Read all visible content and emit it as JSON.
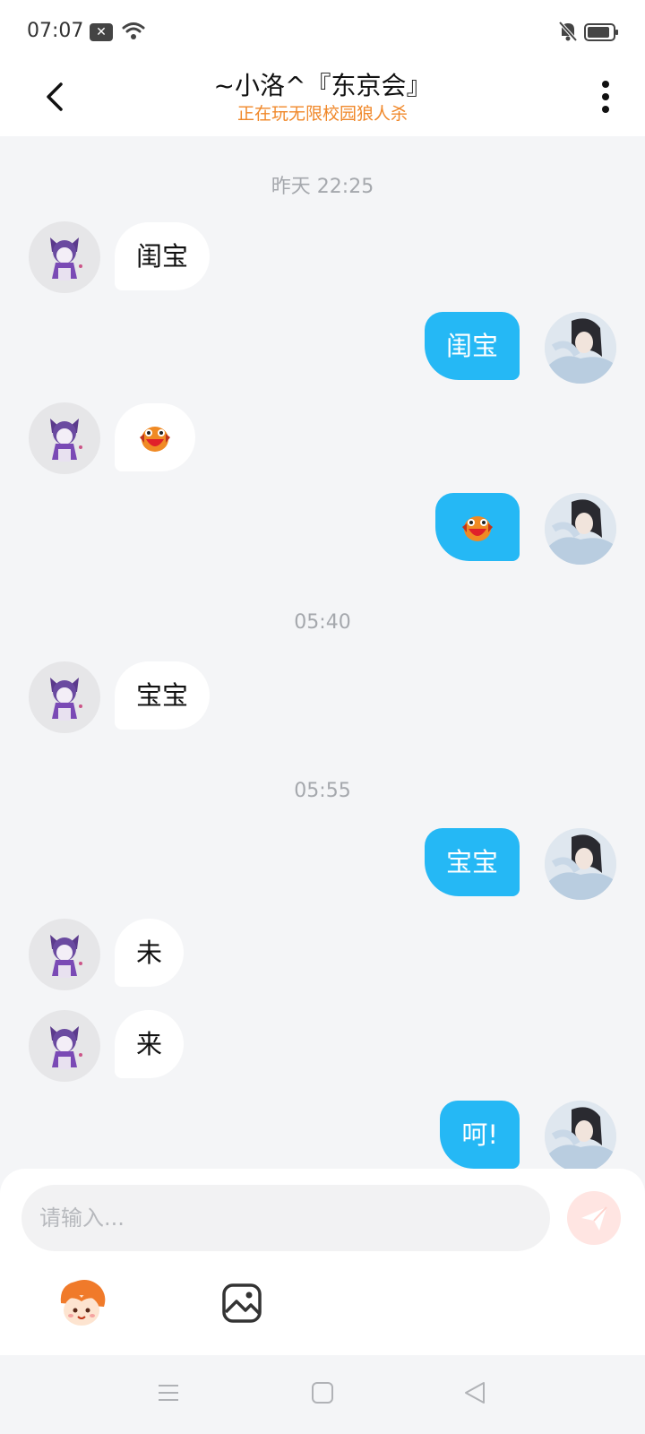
{
  "status": {
    "time": "07:07",
    "notification_icon": "close-notification-icon",
    "wifi_icon": "wifi-icon",
    "silent_icon": "bell-off-icon",
    "battery_icon": "battery-icon"
  },
  "header": {
    "title": "~小洛^『东京会』",
    "subtitle": "正在玩无限校园狼人杀",
    "back_icon": "chevron-left-icon",
    "more_icon": "more-vertical-icon"
  },
  "colors": {
    "accent": "#25b8f5",
    "subtitle": "#f0882a",
    "background": "#f4f5f7"
  },
  "chat": {
    "timestamps": [
      "昨天 22:25",
      "05:40",
      "05:55"
    ],
    "messages": [
      {
        "side": "left",
        "text": "闺宝"
      },
      {
        "side": "right",
        "text": "闺宝"
      },
      {
        "side": "left",
        "sticker": "red-bird-sticker"
      },
      {
        "side": "right",
        "sticker": "red-bird-sticker"
      },
      {
        "side": "left",
        "text": "宝宝"
      },
      {
        "side": "right",
        "text": "宝宝"
      },
      {
        "side": "left",
        "text": "未"
      },
      {
        "side": "left",
        "text": "来"
      },
      {
        "side": "right",
        "text": "呵!"
      }
    ]
  },
  "composer": {
    "placeholder": "请输入...",
    "send_icon": "paper-plane-icon",
    "emoji_icon": "emoji-mascot-icon",
    "image_icon": "image-icon"
  },
  "navbar": {
    "menu_icon": "menu-icon",
    "home_icon": "home-square-icon",
    "back_icon": "back-triangle-icon"
  }
}
